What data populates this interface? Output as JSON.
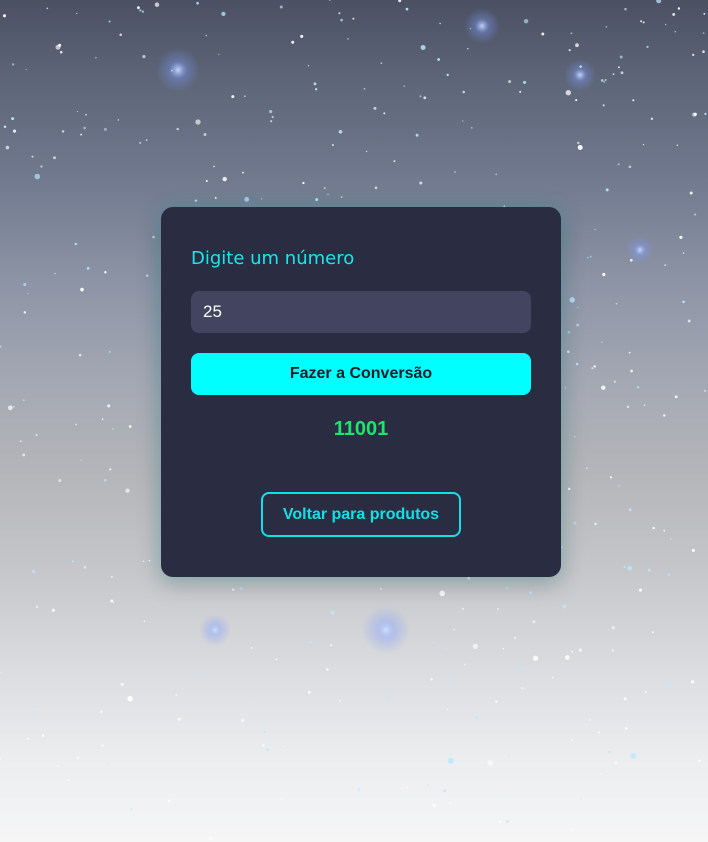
{
  "converter": {
    "label": "Digite um número",
    "input_value": "25",
    "convert_button": "Fazer a Conversão",
    "result": "11001",
    "back_button": "Voltar para produtos"
  },
  "colors": {
    "card_background": "#2a2d42",
    "accent_cyan": "#00ffff",
    "result_green": "#1ce56b",
    "input_background": "#43445f"
  }
}
